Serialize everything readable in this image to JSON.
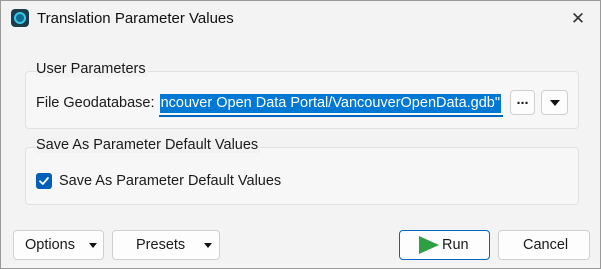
{
  "window": {
    "title": "Translation Parameter Values",
    "close_glyph": "✕"
  },
  "user_params": {
    "group_label": "User Parameters",
    "field_label": "File Geodatabase:",
    "field_value": "\"…Vancouver Open Data Portal/VancouverOpenData.gdb\"",
    "visible_value": "ncouver Open Data Portal/VancouverOpenData.gdb\"",
    "browse_label": "..."
  },
  "save_defaults": {
    "group_label": "Save As Parameter Default Values",
    "checkbox_label": "Save As Parameter Default Values",
    "checked": true
  },
  "buttons": {
    "options": "Options",
    "presets": "Presets",
    "run": "Run",
    "cancel": "Cancel"
  },
  "colors": {
    "accent": "#0067c0",
    "selection": "#0078d4",
    "run_icon": "#2ea043"
  },
  "icons": [
    "app-icon",
    "close-icon",
    "dropdown-arrow-icon",
    "checkmark-icon",
    "caret-down-icon",
    "play-icon"
  ]
}
